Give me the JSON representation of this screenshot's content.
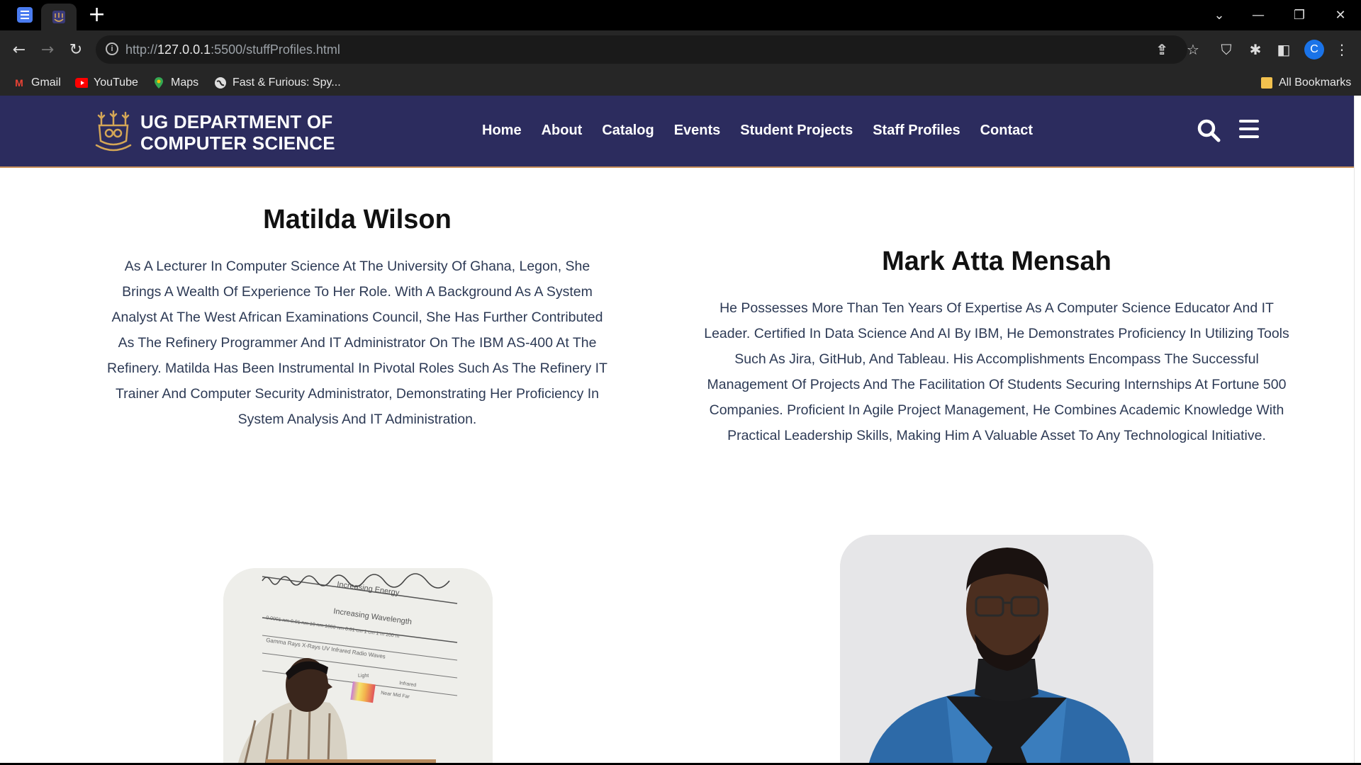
{
  "browser": {
    "url_prefix": "http://",
    "url_host": "127.0.0.1",
    "url_rest": ":5500/stuffProfiles.html",
    "profile_initial": "C",
    "bookmarks": [
      {
        "label": "Gmail",
        "icon": "gmail-icon"
      },
      {
        "label": "YouTube",
        "icon": "youtube-icon"
      },
      {
        "label": "Maps",
        "icon": "maps-icon"
      },
      {
        "label": "Fast & Furious: Spy...",
        "icon": "globe-icon"
      }
    ],
    "all_bookmarks": "All Bookmarks"
  },
  "site": {
    "title_line1": "UG DEPARTMENT OF",
    "title_line2": "COMPUTER SCIENCE",
    "nav": [
      "Home",
      "About",
      "Catalog",
      "Events",
      "Student Projects",
      "Staff Profiles",
      "Contact"
    ],
    "colors": {
      "header_bg": "#2c2c5e",
      "header_border": "#c8905a",
      "bio_text": "#2d3a55"
    }
  },
  "profiles": [
    {
      "name": "Matilda Wilson",
      "bio": "As A Lecturer In Computer Science At The University Of Ghana, Legon, She Brings A Wealth Of Experience To Her Role. With A Background As A System Analyst At The West African Examinations Council, She Has Further Contributed As The Refinery Programmer And IT Administrator On The IBM AS-400 At The Refinery. Matilda Has Been Instrumental In Pivotal Roles Such As The Refinery IT Trainer And Computer Security Administrator, Demonstrating Her Proficiency In System Analysis And IT Administration.",
      "photo_text": {
        "energy": "Increasing Energy",
        "wavelength": "Increasing Wavelength",
        "scale": "0.0001 nm  0.01 nm      10 nm  1000 nm  0.01 cm    1 cm      1 m     100 m",
        "bands": "Gamma Rays     X-Rays     UV     Infrared          Radio Waves",
        "light": "Light",
        "ir": "Infrared",
        "ir_parts": "Near   Mid    Far"
      }
    },
    {
      "name": "Mark Atta Mensah",
      "bio": "He Possesses More Than Ten Years Of Expertise As A Computer Science Educator And IT Leader. Certified In Data Science And AI By IBM, He Demonstrates Proficiency In Utilizing Tools Such As Jira, GitHub, And Tableau. His Accomplishments Encompass The Successful Management Of Projects And The Facilitation Of Students Securing Internships At Fortune 500 Companies. Proficient In Agile Project Management, He Combines Academic Knowledge With Practical Leadership Skills, Making Him A Valuable Asset To Any Technological Initiative."
    }
  ]
}
